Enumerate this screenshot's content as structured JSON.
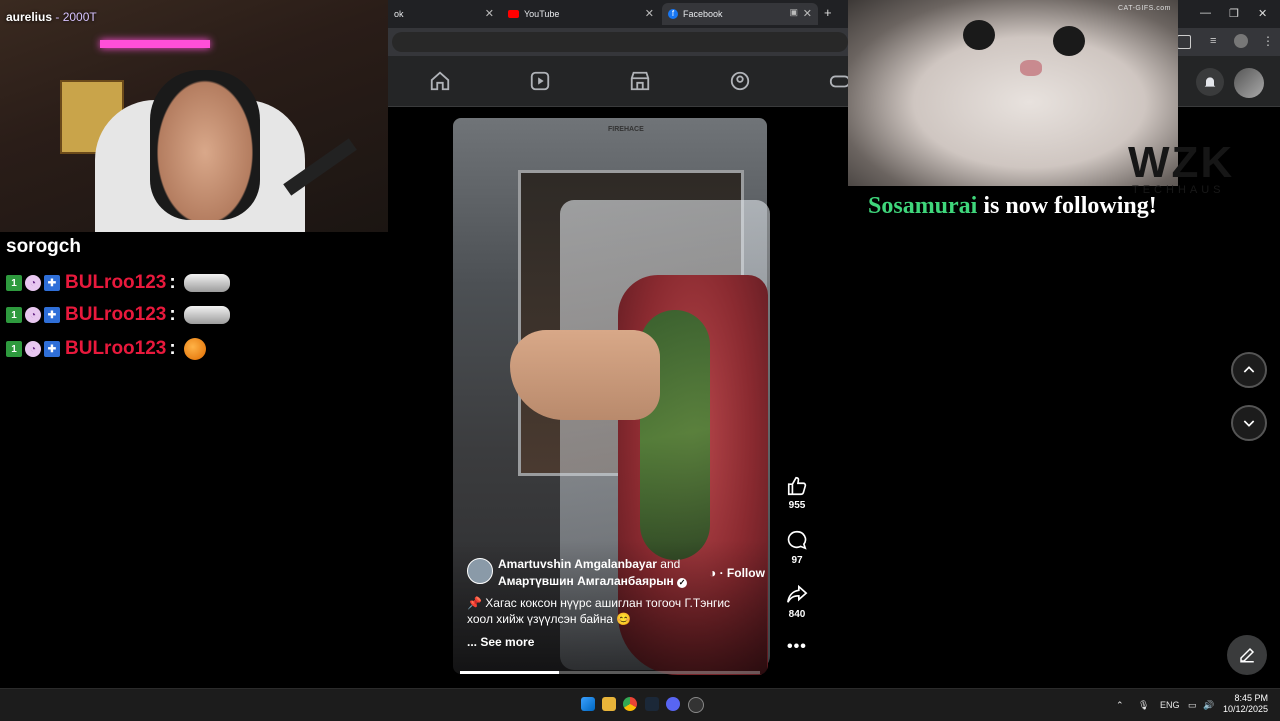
{
  "stream": {
    "cam_user": "aurelius",
    "cam_points": "- 2000T",
    "chat_channel": "sorogch",
    "chat": [
      {
        "badges": [
          "1ST",
          "mask",
          "flag"
        ],
        "user": "BULroo123",
        "emote": "car"
      },
      {
        "badges": [
          "1ST",
          "mask",
          "flag"
        ],
        "user": "BULroo123",
        "emote": "car"
      },
      {
        "badges": [
          "1ST",
          "mask",
          "flag"
        ],
        "user": "BULroo123",
        "emote": "orange"
      }
    ],
    "follow_alert_name": "Sosamurai",
    "follow_alert_text": " is now following!",
    "cat_watermark": "CAT-GIFS.com",
    "overlay_logo": "WZK",
    "overlay_logo_sub": "TECHHAUS"
  },
  "browser": {
    "tabs": [
      {
        "label": "ok",
        "active": false
      },
      {
        "label": "YouTube",
        "active": false
      },
      {
        "label": "Facebook",
        "active": true
      }
    ],
    "new_tab": "+"
  },
  "reel": {
    "author_1": "Amartuvshin Amgalanbayar",
    "and": " and",
    "author_2": "Амартүвшин Амгаланбаярын",
    "follow": "· Follow",
    "caption": "📌 Хагас коксон нүүрс ашиглан тогооч Г.Тэнгис хоол хийж үзүүлсэн байна 😊",
    "see_more": "... See more",
    "fridge_label": "FIREHACE",
    "progress": 0.33,
    "likes": "955",
    "comments": "97",
    "shares": "840"
  },
  "taskbar": {
    "lang": "ENG",
    "time": "8:45 PM",
    "date": "10/12/2025"
  },
  "colors": {
    "accent_fb": "#1877f2",
    "chat_user": "#e8193c",
    "follow_name": "#3fd67b"
  }
}
